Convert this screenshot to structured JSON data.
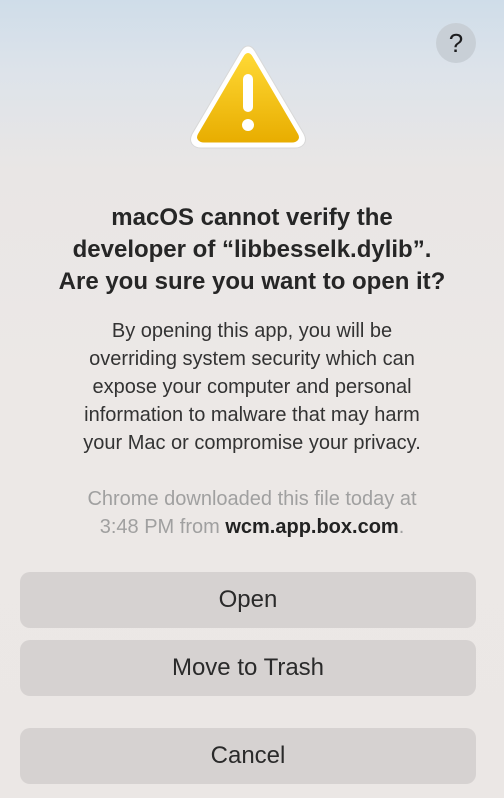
{
  "dialog": {
    "help_label": "?",
    "icon_name": "warning-triangle-icon",
    "title_lines": [
      "macOS cannot verify the",
      "developer of “libbesselk.dylib”.",
      "Are you sure you want to open it?"
    ],
    "message_lines": [
      "By opening this app, you will be",
      "overriding system security which can",
      "expose your computer and personal",
      "information to malware that may harm",
      "your Mac or compromise your privacy."
    ],
    "source": {
      "line1": "Chrome downloaded this file today at",
      "line2_prefix": "3:48 PM from ",
      "domain": "wcm.app.box.com",
      "line2_suffix": "."
    },
    "buttons": {
      "open": "Open",
      "move_to_trash": "Move to Trash",
      "cancel": "Cancel"
    }
  },
  "colors": {
    "warning_yellow": "#f5c400",
    "button_bg": "#d6d2d1",
    "text_primary": "#262626",
    "text_muted": "#a0a0a0"
  }
}
